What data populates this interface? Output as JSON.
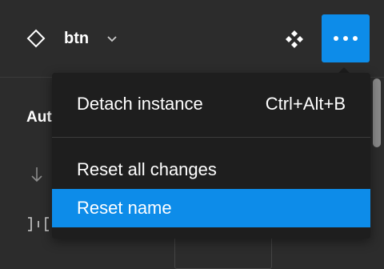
{
  "header": {
    "component_name": "btn",
    "icons": {
      "instance": "diamond-outline-icon",
      "chevron": "chevron-down-icon",
      "components": "four-diamonds-component-icon",
      "more": "three-dots-more-icon"
    },
    "accent_color": "#0d8ce9"
  },
  "panel": {
    "heading_partial": "Aut"
  },
  "menu": {
    "items": [
      {
        "label": "Detach instance",
        "shortcut": "Ctrl+Alt+B",
        "highlighted": false
      },
      {
        "label": "Reset all changes",
        "shortcut": "",
        "highlighted": false
      },
      {
        "label": "Reset name",
        "shortcut": "",
        "highlighted": true
      }
    ]
  },
  "colors": {
    "background": "#2c2c2c",
    "menu_background": "#1e1e1e",
    "highlight": "#0d8ce9",
    "text": "#ffffff"
  }
}
